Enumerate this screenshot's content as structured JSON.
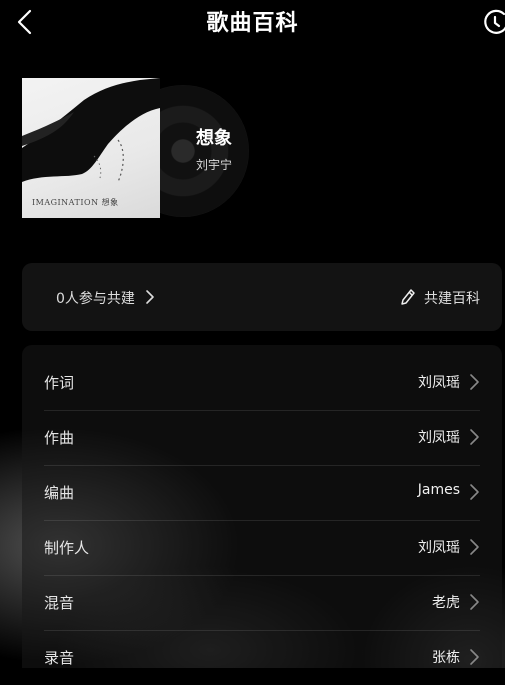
{
  "header": {
    "title": "歌曲百科"
  },
  "song": {
    "title": "想象",
    "artist": "刘宇宁",
    "cover_text": "IMAGINATION 想象"
  },
  "contribute": {
    "count_label": "0人参与共建",
    "action_label": "共建百科"
  },
  "credits": [
    {
      "role": "作词",
      "person": "刘凤瑶"
    },
    {
      "role": "作曲",
      "person": "刘凤瑶"
    },
    {
      "role": "编曲",
      "person": "James"
    },
    {
      "role": "制作人",
      "person": "刘凤瑶"
    },
    {
      "role": "混音",
      "person": "老虎"
    },
    {
      "role": "录音",
      "person": "张栋"
    }
  ],
  "icons": {
    "back": "chevron-left-icon",
    "history": "history-icon",
    "edit": "pencil-icon",
    "row_arrow": "chevron-right-icon"
  }
}
